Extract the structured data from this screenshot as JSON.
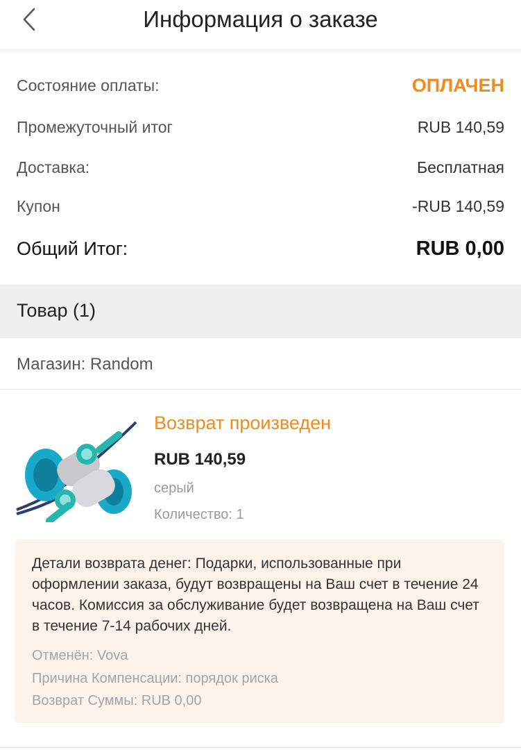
{
  "header": {
    "title": "Информация о заказе",
    "back_icon": "chevron-left-icon"
  },
  "summary": {
    "payment_status_label": "Состояние оплаты:",
    "payment_status_value": "ОПЛАЧЕН",
    "subtotal_label": "Промежуточный итог",
    "subtotal_value": "RUB 140,59",
    "shipping_label": "Доставка:",
    "shipping_value": "Бесплатная",
    "coupon_label": "Купон",
    "coupon_value": "-RUB 140,59",
    "total_label": "Общий Итог:",
    "total_value": "RUB 0,00"
  },
  "items_section": {
    "title": "Товар (1)"
  },
  "store": {
    "label": "Магазин: Random"
  },
  "product": {
    "status": "Возврат произведен",
    "price": "RUB 140,59",
    "color": "серый",
    "quantity": "Количество: 1",
    "image_icon": "earphones-image"
  },
  "refund": {
    "details": "Детали возврата денег: Подарки, использованные при оформлении заказа, будут возвращены на Ваш счет в течение 24 часов. Комиссия за обслуживание будет возвращена на Ваш счет в течение 7-14 рабочих дней.",
    "cancelled_by": "Отменён: Vova",
    "reason": "Причина Компенсации: порядок риска",
    "amount": "Возврат Суммы: RUB 0,00"
  },
  "colors": {
    "accent": "#f28b1a",
    "refund_bg": "#fdf3ea",
    "section_bg": "#efefef"
  }
}
